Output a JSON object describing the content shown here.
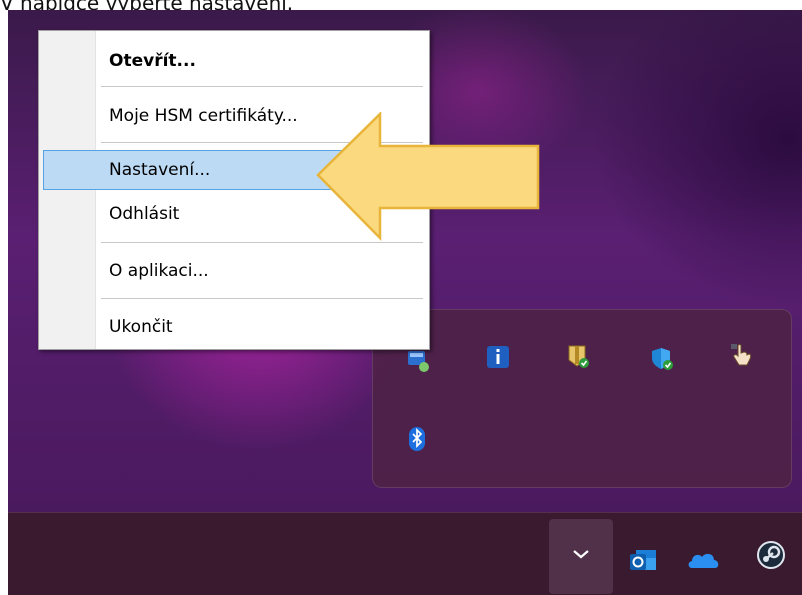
{
  "caption": {
    "text": "V nabídce vyberte nastavení."
  },
  "context_menu": {
    "items": [
      {
        "label": "Otevřít...",
        "bold": true
      },
      {
        "label": "Moje HSM certifikáty..."
      },
      {
        "label": "Nastavení...",
        "highlighted": true
      },
      {
        "label": "Odhlásit"
      },
      {
        "label": "O aplikaci..."
      },
      {
        "label": "Ukončit"
      }
    ]
  },
  "annotation": {
    "icon": "arrow-left-icon",
    "color": "#fbd97f",
    "stroke": "#e8b43a"
  },
  "tray_overflow": {
    "icons": [
      "windows-security-app-icon",
      "info-icon",
      "certificate-shield-icon",
      "defender-shield-icon",
      "hand-pointer-icon",
      "bluetooth-icon"
    ]
  },
  "taskbar": {
    "icons": [
      "chevron-up-icon",
      "outlook-icon",
      "onedrive-icon",
      "steam-icon"
    ]
  },
  "colors": {
    "menu_highlight": "#bcdaf4",
    "menu_highlight_border": "#55a2e6",
    "taskbar": "#3a1a2e"
  }
}
